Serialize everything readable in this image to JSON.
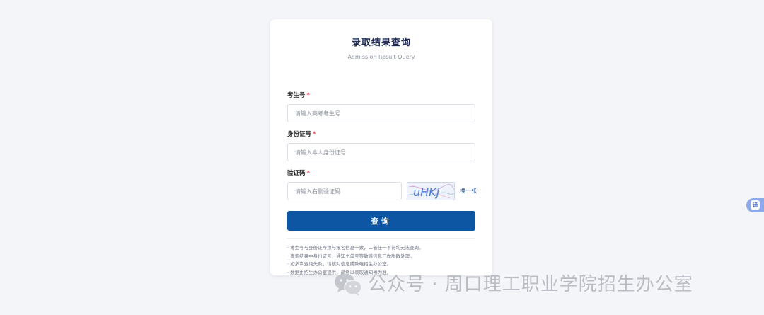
{
  "form": {
    "title": "录取结果查询",
    "subtitle": "Admission Result Query",
    "required_mark": "*",
    "fields": [
      {
        "label": "考生号",
        "placeholder": "请输入高考考生号",
        "value": ""
      },
      {
        "label": "身份证号",
        "placeholder": "请输入本人身份证号",
        "value": ""
      },
      {
        "label": "验证码",
        "placeholder": "请输入右侧验证码",
        "value": ""
      }
    ],
    "captcha": {
      "icon": "captcha-image",
      "text": "uHKj"
    },
    "refresh_label": "换一张",
    "submit_label": "查询",
    "notes": [
      "· 考生号与身份证号须与报名信息一致，二者任一不符均无法查询。",
      "· 查询结果中身份证号、通知书单号等敏感信息已做脱敏处理。",
      "· 如多次查询失败，请核对信息或致电招生办公室。",
      "· 数据由招生办公室提供，最终以录取通知书为准。"
    ]
  },
  "translate_badge": {
    "label": "译"
  },
  "watermark": {
    "icon": "wechat-icon",
    "text": "公众号 · 周口理工职业学院招生办公室"
  },
  "colors": {
    "primary": "#0d56a3",
    "required": "#e5484d",
    "link": "#1f4f9a",
    "badge": "#8ea9ea",
    "background": "#f4f5f8"
  }
}
